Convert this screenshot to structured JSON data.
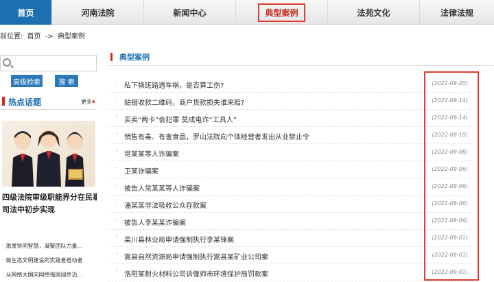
{
  "nav": {
    "items": [
      {
        "label": "首页"
      },
      {
        "label": "河南法院"
      },
      {
        "label": "新闻中心"
      },
      {
        "label": "典型案例"
      },
      {
        "label": "法苑文化"
      },
      {
        "label": "法律法规"
      }
    ]
  },
  "breadcrumb": {
    "prefix": "前位置:",
    "home": "首页",
    "sep": "->",
    "current": "典型案例"
  },
  "search": {
    "value": "",
    "advanced_label": "高级检索",
    "search_label": "搜 索"
  },
  "hot": {
    "title": "热点话题",
    "more": "更多",
    "headline_line1": "四级法院审级职能界分在民事",
    "headline_line2": "司法中初步实现",
    "items": [
      "激发协同智慧，凝聚团队力量...",
      "做生态文明建设的实践者推动者",
      "从网络大国向网络强国阔步迈..."
    ]
  },
  "cases": {
    "title": "典型案例",
    "items": [
      {
        "title": "私下换班路遇车祸，是否算工伤?",
        "date": "(2022-09-20)"
      },
      {
        "title": "贴错收款二维码，商户货款损失谁来赔?",
        "date": "(2022-09-14)"
      },
      {
        "title": "买卖“两卡”会犯罪 莫成电诈“工具人”",
        "date": "(2022-09-14)"
      },
      {
        "title": "销售有毒、有害食品，罗山法院向个体经营者发出从业禁止令",
        "date": "(2022-09-10)"
      },
      {
        "title": "常某某等人诈骗案",
        "date": "(2022-09-06)"
      },
      {
        "title": "卫某诈骗案",
        "date": "(2022-09-06)"
      },
      {
        "title": "被告人常某某等人诈骗案",
        "date": "(2022-09-06)"
      },
      {
        "title": "潘某某非法吸收公众存款案",
        "date": "(2022-09-06)"
      },
      {
        "title": "被告人李某某诈骗案",
        "date": "(2022-09-06)"
      },
      {
        "title": "栾川县林业局申请强制执行李某锋案",
        "date": "(2022-09-01)"
      },
      {
        "title": "嵩县自然资源局申请强制执行嵩县某矿业公司案",
        "date": "(2022-09-01)"
      },
      {
        "title": "洛阳某耐火材料公司诉偃师市环境保护局罚款案",
        "date": "(2022-09-01)"
      }
    ]
  },
  "colors": {
    "accent": "#1e6fb0",
    "highlight": "#e23b2e",
    "marker": "#d2281f"
  }
}
